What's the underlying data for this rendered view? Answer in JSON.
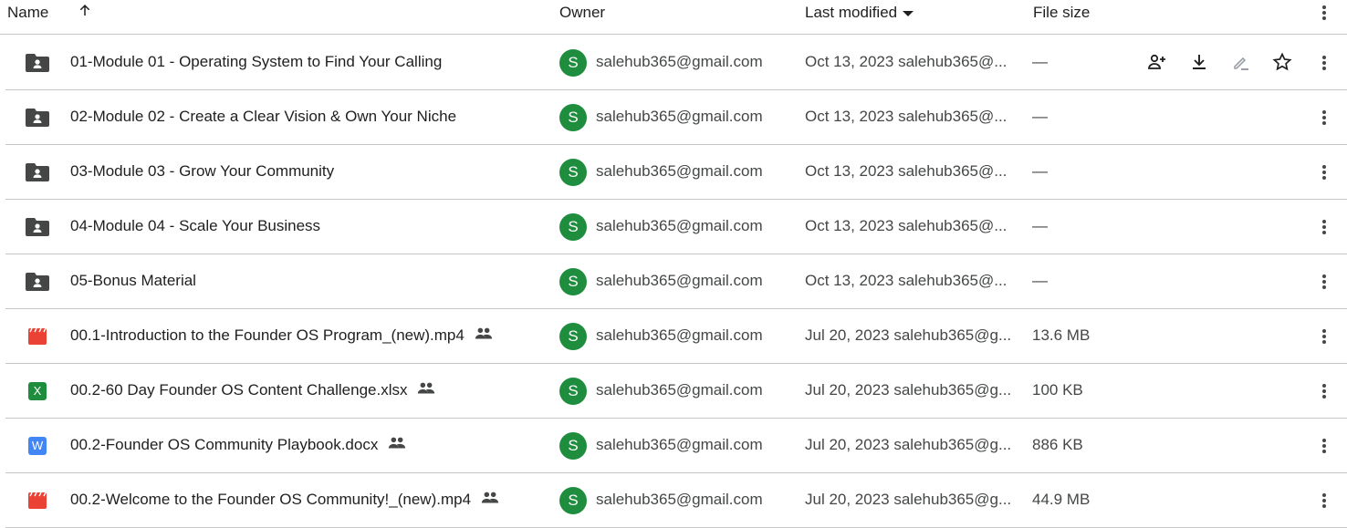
{
  "header": {
    "name": "Name",
    "owner": "Owner",
    "last_modified": "Last modified",
    "file_size": "File size",
    "sort_icon": "arrow-up-icon",
    "more_icon": "more-vert-icon"
  },
  "row_actions": [
    "share-icon",
    "download-icon",
    "rename-icon",
    "star-icon",
    "more-vert-icon"
  ],
  "colors": {
    "folder": "#444746",
    "video": "#ea4335",
    "sheet": "#1e8e3e",
    "doc": "#4285f4",
    "avatar": "#1e8e3e"
  },
  "files": [
    {
      "type": "folder",
      "name": "01-Module 01 - Operating System to Find Your Calling",
      "shared": false,
      "avatar": "S",
      "owner": "salehub365@gmail.com",
      "modified": "Oct 13, 2023 salehub365@...",
      "size": "—"
    },
    {
      "type": "folder",
      "name": "02-Module 02 - Create a Clear Vision & Own Your Niche",
      "shared": false,
      "avatar": "S",
      "owner": "salehub365@gmail.com",
      "modified": "Oct 13, 2023 salehub365@...",
      "size": "—"
    },
    {
      "type": "folder",
      "name": "03-Module 03 - Grow Your Community",
      "shared": false,
      "avatar": "S",
      "owner": "salehub365@gmail.com",
      "modified": "Oct 13, 2023 salehub365@...",
      "size": "—"
    },
    {
      "type": "folder",
      "name": "04-Module 04 - Scale Your Business",
      "shared": false,
      "avatar": "S",
      "owner": "salehub365@gmail.com",
      "modified": "Oct 13, 2023 salehub365@...",
      "size": "—"
    },
    {
      "type": "folder",
      "name": "05-Bonus Material",
      "shared": false,
      "avatar": "S",
      "owner": "salehub365@gmail.com",
      "modified": "Oct 13, 2023 salehub365@...",
      "size": "—"
    },
    {
      "type": "video",
      "name": "00.1-Introduction to the Founder OS Program_(new).mp4",
      "shared": true,
      "avatar": "S",
      "owner": "salehub365@gmail.com",
      "modified": "Jul 20, 2023 salehub365@g...",
      "size": "13.6 MB"
    },
    {
      "type": "sheet",
      "badge": "X",
      "name": "00.2-60 Day Founder OS Content Challenge.xlsx",
      "shared": true,
      "avatar": "S",
      "owner": "salehub365@gmail.com",
      "modified": "Jul 20, 2023 salehub365@g...",
      "size": "100 KB"
    },
    {
      "type": "doc",
      "badge": "W",
      "name": "00.2-Founder OS Community Playbook.docx",
      "shared": true,
      "avatar": "S",
      "owner": "salehub365@gmail.com",
      "modified": "Jul 20, 2023 salehub365@g...",
      "size": "886 KB"
    },
    {
      "type": "video",
      "name": "00.2-Welcome to the Founder OS Community!_(new).mp4",
      "shared": true,
      "avatar": "S",
      "owner": "salehub365@gmail.com",
      "modified": "Jul 20, 2023 salehub365@g...",
      "size": "44.9 MB"
    }
  ]
}
